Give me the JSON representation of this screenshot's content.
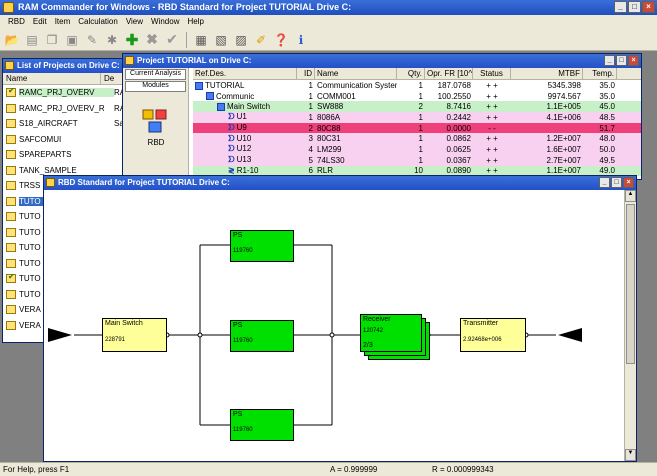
{
  "app": {
    "title": "RAM Commander for Windows - RBD Standard for Project TUTORIAL Drive C:"
  },
  "menu": [
    "RBD",
    "Edit",
    "Item",
    "Calculation",
    "View",
    "Window",
    "Help"
  ],
  "toolbar_icons": [
    "open-folder-icon",
    "open-icon",
    "copy-icon",
    "paste-icon",
    "properties-icon",
    "wizard-icon",
    "add-icon",
    "delete-icon",
    "check-icon",
    "table-icon",
    "report-icon",
    "chart-icon",
    "notes-icon",
    "help-icon",
    "info-icon"
  ],
  "status": {
    "help": "For Help, press F1",
    "a": "A = 0.999999",
    "r": "R = 0.000999343"
  },
  "project_list": {
    "title": "List of Projects on Drive C:",
    "col_name": "Name",
    "col_desc": "De",
    "items": [
      {
        "name": "RAMC_PRJ_OVERV",
        "desc": "RAM",
        "check": true,
        "style": "green"
      },
      {
        "name": "RAMC_PRJ_OVERV_R",
        "desc": "RAM",
        "check": false,
        "style": ""
      },
      {
        "name": "S18_AIRCRAFT",
        "desc": "Safe",
        "check": false,
        "style": ""
      },
      {
        "name": "SAFCOMUI",
        "desc": "",
        "check": false,
        "style": ""
      },
      {
        "name": "SPAREPARTS",
        "desc": "",
        "check": false,
        "style": ""
      },
      {
        "name": "TANK_SAMPLE",
        "desc": "",
        "check": false,
        "style": ""
      },
      {
        "name": "TRSS",
        "desc": "",
        "check": false,
        "style": ""
      },
      {
        "name": "TUTO",
        "desc": "",
        "check": false,
        "style": "sel"
      },
      {
        "name": "TUTO",
        "desc": "",
        "check": false,
        "style": ""
      },
      {
        "name": "TUTO",
        "desc": "",
        "check": false,
        "style": ""
      },
      {
        "name": "TUTO",
        "desc": "",
        "check": false,
        "style": ""
      },
      {
        "name": "TUTO",
        "desc": "",
        "check": false,
        "style": ""
      },
      {
        "name": "TUTO",
        "desc": "",
        "check": true,
        "style": ""
      },
      {
        "name": "TUTO",
        "desc": "",
        "check": false,
        "style": ""
      },
      {
        "name": "VERA",
        "desc": "",
        "check": false,
        "style": ""
      },
      {
        "name": "VERA",
        "desc": "",
        "check": false,
        "style": ""
      }
    ]
  },
  "project_window": {
    "title": "Project TUTORIAL on Drive C:",
    "tabs": [
      "Current Analysis",
      "Modules"
    ],
    "module_label": "RBD",
    "columns": [
      "Ref.Des.",
      "ID",
      "Name",
      "Qty.",
      "Opr. FR [10^-6]",
      "Status",
      "MTBF",
      "Temp."
    ],
    "rows": [
      {
        "ref": "TUTORIAL",
        "id": "1",
        "name": "Communication System",
        "qty": "1",
        "fr": "187.0768",
        "status": "+ +",
        "mtbf": "5345.398",
        "temp": "35.0",
        "style": "",
        "indent": 0,
        "kind": "box"
      },
      {
        "ref": "Communic",
        "id": "1",
        "name": "COMM001",
        "qty": "1",
        "fr": "100.2550",
        "status": "+ +",
        "mtbf": "9974.567",
        "temp": "35.0",
        "style": "",
        "indent": 1,
        "kind": "box"
      },
      {
        "ref": "Main Switch",
        "id": "1",
        "name": "SW888",
        "qty": "2",
        "fr": "8.7416",
        "status": "+ +",
        "mtbf": "1.1E+005",
        "temp": "45.0",
        "style": "green",
        "indent": 2,
        "kind": "box"
      },
      {
        "ref": "U1",
        "id": "1",
        "name": "8086A",
        "qty": "1",
        "fr": "0.2442",
        "status": "+ +",
        "mtbf": "4.1E+006",
        "temp": "48.5",
        "style": "pink",
        "indent": 3,
        "kind": "comp"
      },
      {
        "ref": "U9",
        "id": "2",
        "name": "80C88",
        "qty": "1",
        "fr": "0.0000",
        "status": "- -",
        "mtbf": "",
        "temp": "51.7",
        "style": "red",
        "indent": 3,
        "kind": "comp"
      },
      {
        "ref": "U10",
        "id": "3",
        "name": "80C31",
        "qty": "1",
        "fr": "0.0862",
        "status": "+ +",
        "mtbf": "1.2E+007",
        "temp": "48.0",
        "style": "pink",
        "indent": 3,
        "kind": "comp"
      },
      {
        "ref": "U12",
        "id": "4",
        "name": "LM299",
        "qty": "1",
        "fr": "0.0625",
        "status": "+ +",
        "mtbf": "1.6E+007",
        "temp": "50.0",
        "style": "pink",
        "indent": 3,
        "kind": "comp"
      },
      {
        "ref": "U13",
        "id": "5",
        "name": "74LS30",
        "qty": "1",
        "fr": "0.0367",
        "status": "+ +",
        "mtbf": "2.7E+007",
        "temp": "49.5",
        "style": "pink",
        "indent": 3,
        "kind": "comp"
      },
      {
        "ref": "R1-10",
        "id": "6",
        "name": "RLR",
        "qty": "10",
        "fr": "0.0890",
        "status": "+ +",
        "mtbf": "1.1E+007",
        "temp": "49.0",
        "style": "green",
        "indent": 3,
        "kind": "res"
      }
    ]
  },
  "rbd_window": {
    "title": "RBD Standard for Project TUTORIAL Drive C:",
    "blocks": {
      "main_switch": {
        "name": "Main Switch",
        "value": "228791"
      },
      "ps1": {
        "name": "PS",
        "value": "119760"
      },
      "ps2": {
        "name": "PS",
        "value": "119760"
      },
      "ps3": {
        "name": "PS",
        "value": "119760"
      },
      "receiver": {
        "name": "Receiver",
        "value": "120742",
        "kofn": "2/3"
      },
      "transmitter": {
        "name": "Transmitter",
        "value": "2.92468e+006"
      }
    }
  }
}
